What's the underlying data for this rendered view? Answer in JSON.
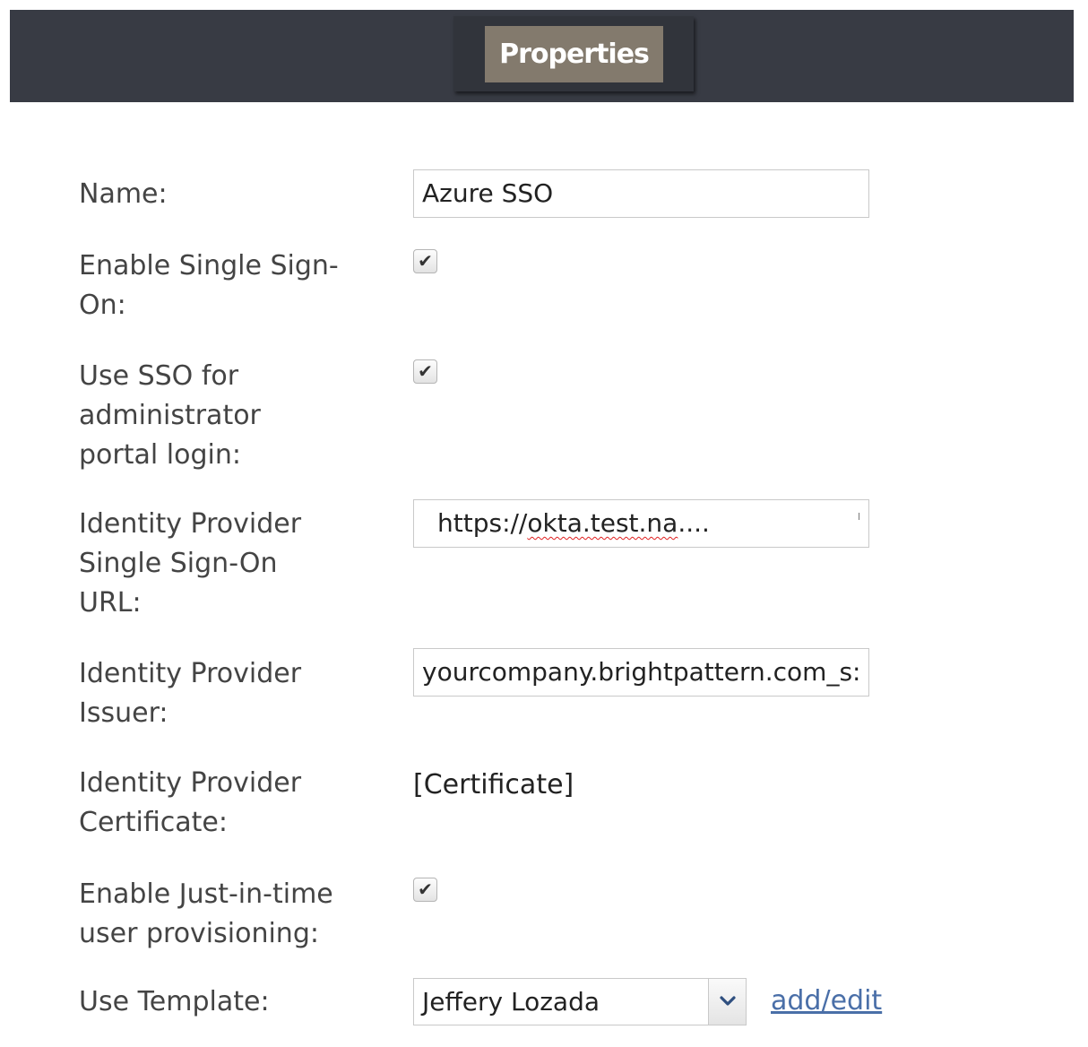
{
  "header": {
    "tab_label": "Properties"
  },
  "form": {
    "name": {
      "label": "Name:",
      "value": "Azure SSO"
    },
    "enable_sso": {
      "label": "Enable Single Sign-On:",
      "checked": true,
      "check_glyph": "✔"
    },
    "admin_portal_sso": {
      "label": "Use SSO for administrator portal login:",
      "checked": true,
      "check_glyph": "✔"
    },
    "idp_sso_url": {
      "label": "Identity Provider Single Sign-On URL:",
      "value_prefix": "https://",
      "value_squiggled": "okta.test.na",
      "value_suffix": "...."
    },
    "idp_issuer": {
      "label": "Identity Provider Issuer:",
      "value": "yourcompany.brightpattern.com_s:"
    },
    "idp_certificate": {
      "label": "Identity Provider Certificate:",
      "value": "[Certificate]"
    },
    "jit_provisioning": {
      "label": "Enable Just-in-time user provisioning:",
      "checked": true,
      "check_glyph": "✔"
    },
    "template": {
      "label": "Use Template:",
      "selected": "Jeffery Lozada",
      "link_label": "add/edit"
    }
  },
  "icons": {
    "checkbox": "checkmark-icon",
    "dropdown": "chevron-down-icon"
  },
  "colors": {
    "header_bg": "#383b44",
    "tab_bg": "#837a6d",
    "link": "#4a6fa8"
  }
}
